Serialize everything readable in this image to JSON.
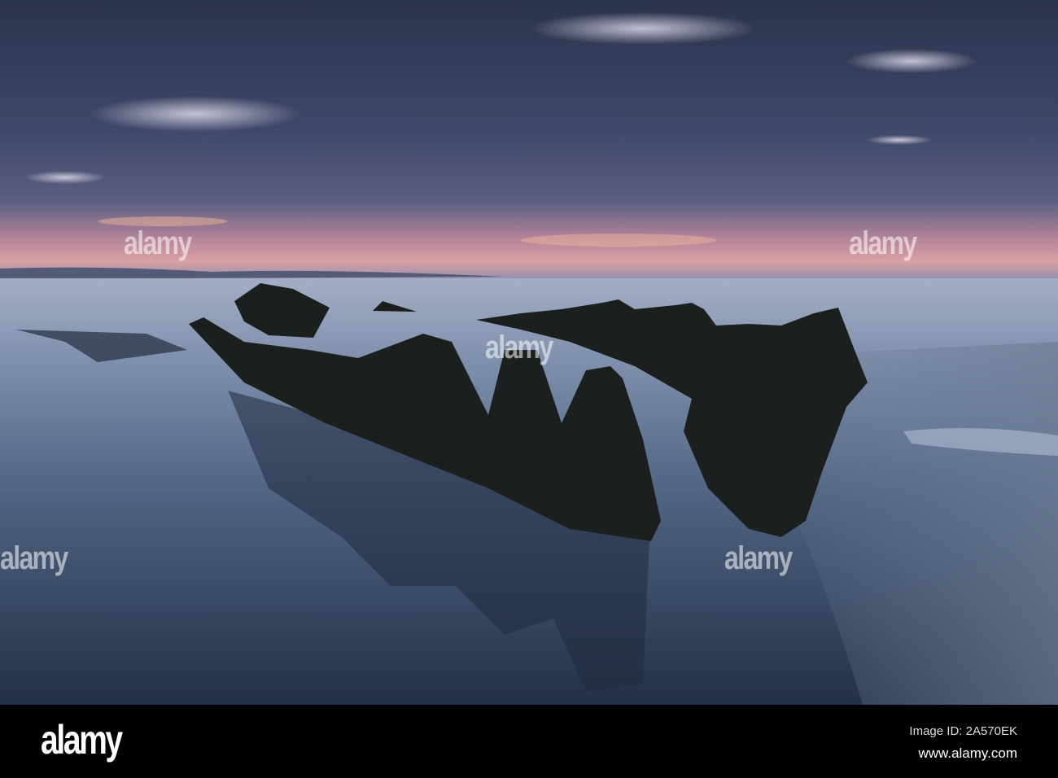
{
  "photo": {
    "subject": "shipwreck",
    "colors": {
      "sky_top": "#2c334d",
      "sky_mid": "#4a5275",
      "horizon": "#c98a98",
      "water_light": "#8b9cb5",
      "water_dark": "#253249",
      "wreck": "#1b1f1d"
    }
  },
  "watermark": {
    "text": "alamy"
  },
  "footer": {
    "logo": "alamy",
    "image_id": "Image ID: 2A570EK",
    "website": "www.alamy.com"
  }
}
